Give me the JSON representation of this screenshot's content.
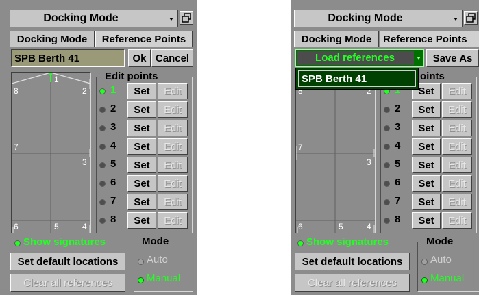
{
  "colors": {
    "panel_bg": "#8c8c8c",
    "button_face": "#c6c6c6",
    "field_bg": "#9a9a78",
    "accent_green": "#22ff22",
    "dropdown_bg": "#004000"
  },
  "left": {
    "title": "Docking Mode",
    "tabs": [
      {
        "label": "Docking Mode"
      },
      {
        "label": "Reference Points"
      }
    ],
    "name_value": "SPB Berth 41",
    "ok_label": "Ok",
    "cancel_label": "Cancel",
    "edit_points_title": "Edit points",
    "schema_labels": {
      "top": "1",
      "left_top": "8",
      "right_top": "2",
      "left_mid": "7",
      "right_mid": "3",
      "bottom_left": "6",
      "bottom_mid": "5",
      "bottom_right": "4"
    },
    "points": [
      {
        "num": "1",
        "set": "Set",
        "edit": "Edit",
        "active": true
      },
      {
        "num": "2",
        "set": "Set",
        "edit": "Edit",
        "active": false
      },
      {
        "num": "3",
        "set": "Set",
        "edit": "Edit",
        "active": false
      },
      {
        "num": "4",
        "set": "Set",
        "edit": "Edit",
        "active": false
      },
      {
        "num": "5",
        "set": "Set",
        "edit": "Edit",
        "active": false
      },
      {
        "num": "6",
        "set": "Set",
        "edit": "Edit",
        "active": false
      },
      {
        "num": "7",
        "set": "Set",
        "edit": "Edit",
        "active": false
      },
      {
        "num": "8",
        "set": "Set",
        "edit": "Edit",
        "active": false
      }
    ],
    "show_signatures": "Show signatures",
    "set_default": "Set default locations",
    "clear_all": "Clear all references",
    "mode_title": "Mode",
    "mode_auto": "Auto",
    "mode_manual": "Manual",
    "mode_selected": "Manual"
  },
  "right": {
    "title": "Docking Mode",
    "tabs": [
      {
        "label": "Docking Mode"
      },
      {
        "label": "Reference Points"
      }
    ],
    "load_references": "Load references",
    "save_as": "Save As",
    "dropdown_items": [
      "SPB Berth 41"
    ],
    "edit_points_title_visible": "oints",
    "schema_labels": {
      "right_top": "2",
      "left_top": "8",
      "left_mid": "7",
      "right_mid": "3",
      "bottom_left": "6",
      "bottom_mid": "5",
      "bottom_right": "4"
    },
    "points": [
      {
        "num": "1",
        "set": "Set",
        "edit": "Edit",
        "active": true
      },
      {
        "num": "2",
        "set": "Set",
        "edit": "Edit",
        "active": false
      },
      {
        "num": "3",
        "set": "Set",
        "edit": "Edit",
        "active": false
      },
      {
        "num": "4",
        "set": "Set",
        "edit": "Edit",
        "active": false
      },
      {
        "num": "5",
        "set": "Set",
        "edit": "Edit",
        "active": false
      },
      {
        "num": "6",
        "set": "Set",
        "edit": "Edit",
        "active": false
      },
      {
        "num": "7",
        "set": "Set",
        "edit": "Edit",
        "active": false
      },
      {
        "num": "8",
        "set": "Set",
        "edit": "Edit",
        "active": false
      }
    ],
    "show_signatures": "Show signatures",
    "set_default": "Set default locations",
    "clear_all": "Clear all references",
    "mode_title": "Mode",
    "mode_auto": "Auto",
    "mode_manual": "Manual",
    "mode_selected": "Manual"
  }
}
